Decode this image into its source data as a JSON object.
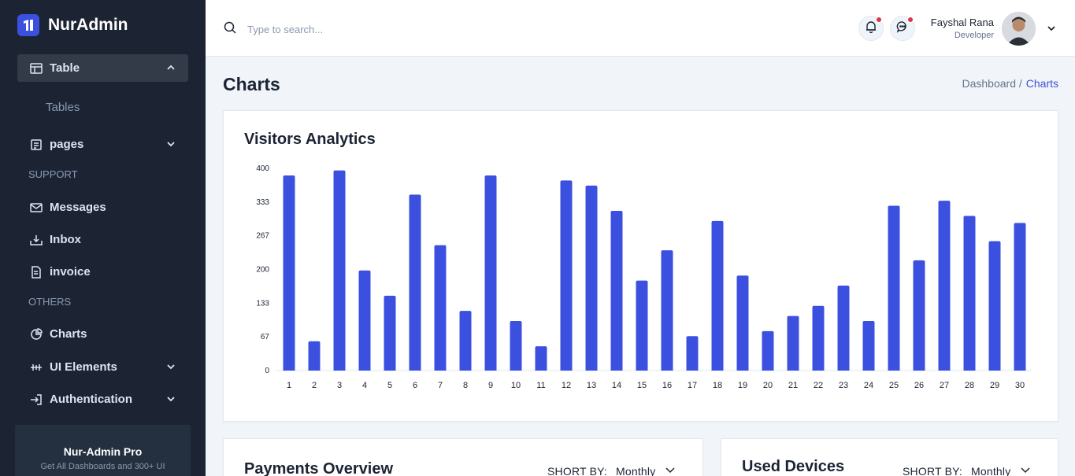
{
  "brand": {
    "name": "NurAdmin"
  },
  "sidebar": {
    "items": [
      {
        "label": "Table"
      },
      {
        "label": "Tables"
      },
      {
        "label": "pages"
      },
      {
        "label": "SUPPORT"
      },
      {
        "label": "Messages"
      },
      {
        "label": "Inbox"
      },
      {
        "label": "invoice"
      },
      {
        "label": "OTHERS"
      },
      {
        "label": "Charts"
      },
      {
        "label": "UI Elements"
      },
      {
        "label": "Authentication"
      }
    ],
    "promo": {
      "title": "Nur-Admin Pro",
      "desc": "Get All Dashboards and 300+ UI"
    }
  },
  "header": {
    "search_placeholder": "Type to search...",
    "user": {
      "name": "Fayshal Rana",
      "role": "Developer"
    }
  },
  "page": {
    "title": "Charts",
    "breadcrumb": {
      "parent": "Dashboard /",
      "current": "Charts"
    }
  },
  "cards": {
    "visitors": {
      "title": "Visitors Analytics"
    },
    "payments": {
      "title": "Payments Overview",
      "sort_label": "SHORT BY:",
      "sort_value": "Monthly"
    },
    "devices": {
      "title": "Used Devices",
      "sort_label": "SHORT BY:",
      "sort_value": "Monthly"
    }
  },
  "colors": {
    "accent": "#3c50e0",
    "sidebar": "#1c2434",
    "bar": "#3c50e0",
    "notification_dot": "#dc3545"
  },
  "chart_data": {
    "type": "bar",
    "title": "Visitors Analytics",
    "categories": [
      "1",
      "2",
      "3",
      "4",
      "5",
      "6",
      "7",
      "8",
      "9",
      "10",
      "11",
      "12",
      "13",
      "14",
      "15",
      "16",
      "17",
      "18",
      "19",
      "20",
      "21",
      "22",
      "23",
      "24",
      "25",
      "26",
      "27",
      "28",
      "29",
      "30"
    ],
    "values": [
      386,
      58,
      396,
      198,
      148,
      348,
      248,
      118,
      386,
      98,
      48,
      376,
      366,
      316,
      178,
      238,
      68,
      296,
      188,
      78,
      108,
      128,
      168,
      98,
      326,
      218,
      336,
      306,
      256,
      292
    ],
    "yticks": [
      "0",
      "67",
      "133",
      "200",
      "267",
      "333",
      "400"
    ],
    "ylim": [
      0,
      400
    ],
    "xlabel": "",
    "ylabel": ""
  }
}
